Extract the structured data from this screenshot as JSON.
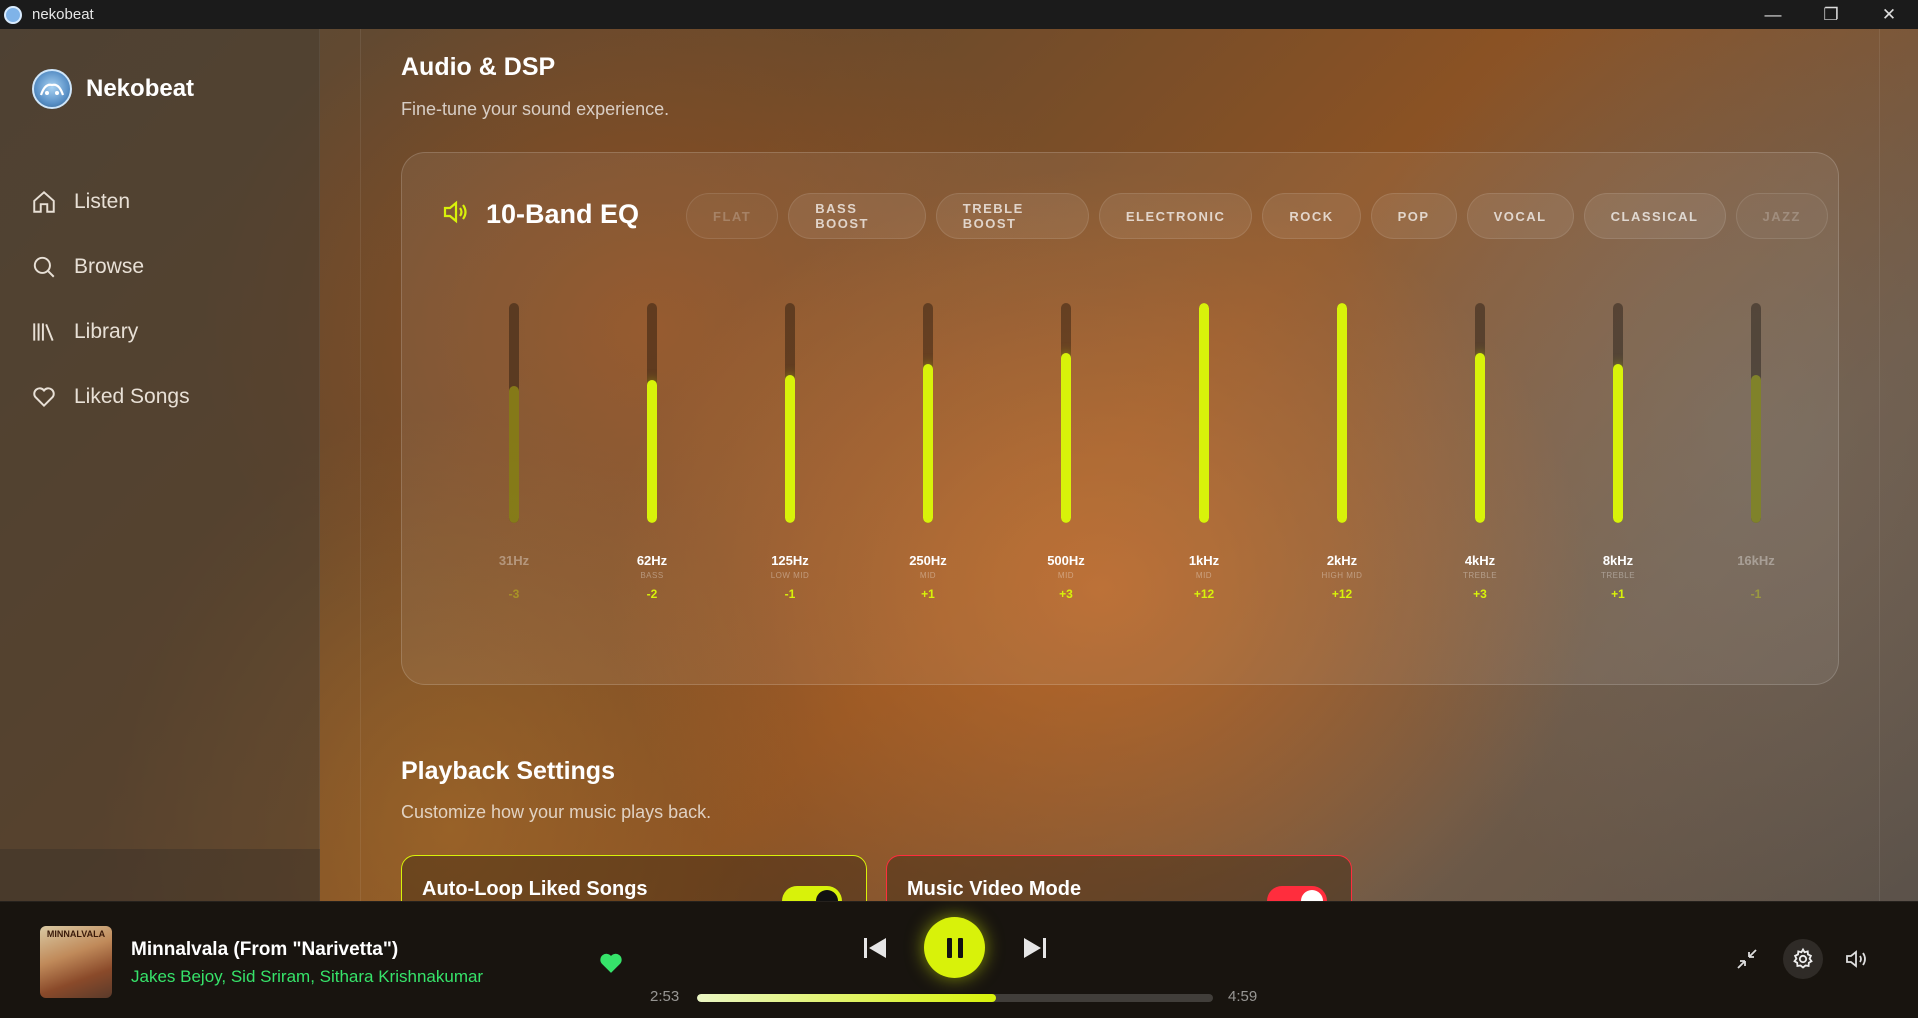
{
  "window": {
    "title": "nekobeat",
    "minimize_glyph": "—",
    "restore_glyph": "❐",
    "close_glyph": "✕"
  },
  "sidebar": {
    "brand": "Nekobeat",
    "items": [
      {
        "label": "Listen",
        "icon": "home-icon"
      },
      {
        "label": "Browse",
        "icon": "search-icon"
      },
      {
        "label": "Library",
        "icon": "library-icon"
      },
      {
        "label": "Liked Songs",
        "icon": "heart-icon"
      }
    ]
  },
  "audio": {
    "title": "Audio & DSP",
    "subtitle": "Fine-tune your sound experience.",
    "eq": {
      "title": "10-Band EQ",
      "accent_color": "#d8f20a",
      "presets": [
        "FLAT",
        "BASS BOOST",
        "TREBLE BOOST",
        "ELECTRONIC",
        "ROCK",
        "POP",
        "VOCAL",
        "CLASSICAL",
        "JAZZ"
      ],
      "bands": [
        {
          "freq": "31Hz",
          "range": "",
          "value": "-3",
          "level": -3
        },
        {
          "freq": "62Hz",
          "range": "BASS",
          "value": "-2",
          "level": -2
        },
        {
          "freq": "125Hz",
          "range": "LOW MID",
          "value": "-1",
          "level": -1
        },
        {
          "freq": "250Hz",
          "range": "MID",
          "value": "+1",
          "level": 1
        },
        {
          "freq": "500Hz",
          "range": "MID",
          "value": "+3",
          "level": 3
        },
        {
          "freq": "1kHz",
          "range": "MID",
          "value": "+12",
          "level": 12
        },
        {
          "freq": "2kHz",
          "range": "HIGH MID",
          "value": "+12",
          "level": 12
        },
        {
          "freq": "4kHz",
          "range": "TREBLE",
          "value": "+3",
          "level": 3
        },
        {
          "freq": "8kHz",
          "range": "TREBLE",
          "value": "+1",
          "level": 1
        },
        {
          "freq": "16kHz",
          "range": "",
          "value": "-1",
          "level": -1
        }
      ]
    }
  },
  "playback": {
    "title": "Playback Settings",
    "subtitle": "Customize how your music plays back.",
    "cards": [
      {
        "label": "Auto-Loop Liked Songs",
        "enabled": true,
        "accent": "#d8f20a"
      },
      {
        "label": "Music Video Mode",
        "enabled": true,
        "accent": "#ff2d3d"
      }
    ]
  },
  "player": {
    "cover_text": "MINNALVALA",
    "track_title": "Minnalvala (From \"Narivetta\")",
    "artists": "Jakes Bejoy, Sid Sriram, Sithara Krishnakumar",
    "liked": true,
    "current_time": "2:53",
    "duration": "4:59",
    "progress_fraction": 0.58
  }
}
